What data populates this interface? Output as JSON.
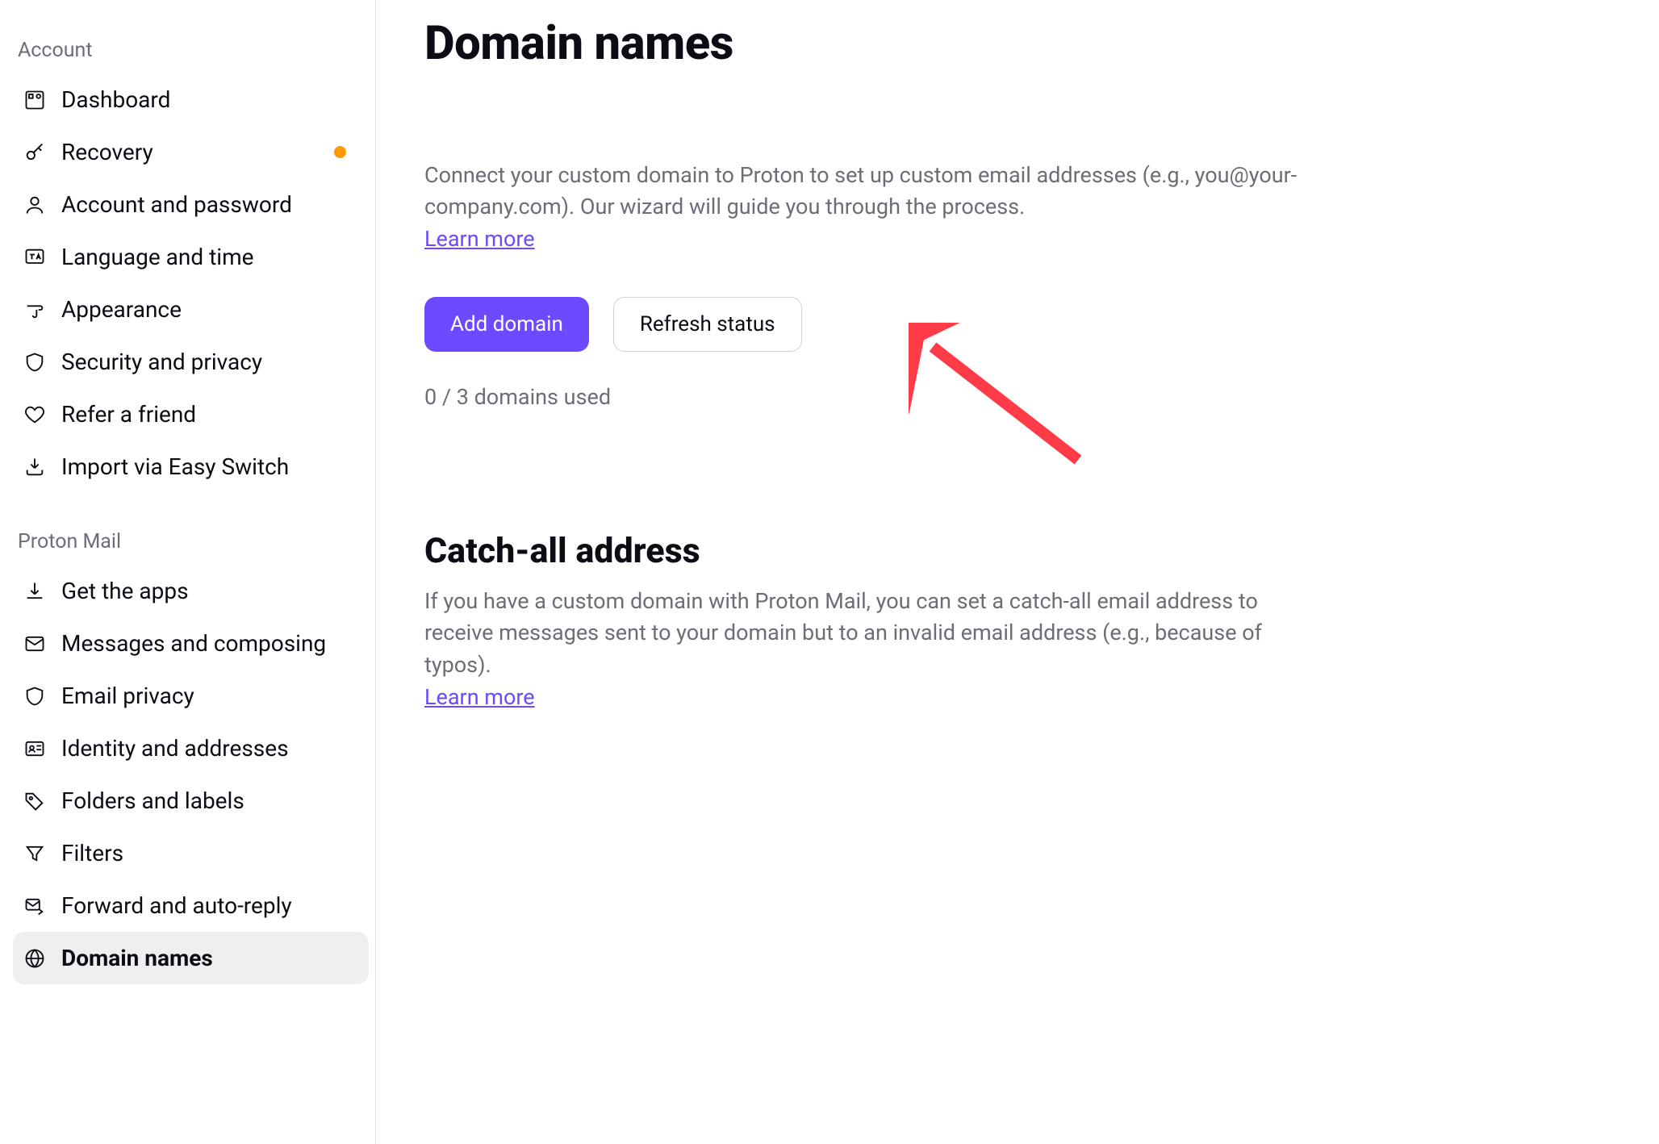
{
  "sidebar": {
    "sections": [
      {
        "header": "Account",
        "items": [
          {
            "label": "Dashboard",
            "icon": "dashboard-icon",
            "hasDot": false,
            "active": false
          },
          {
            "label": "Recovery",
            "icon": "key-icon",
            "hasDot": true,
            "active": false
          },
          {
            "label": "Account and password",
            "icon": "user-icon",
            "hasDot": false,
            "active": false
          },
          {
            "label": "Language and time",
            "icon": "language-icon",
            "hasDot": false,
            "active": false
          },
          {
            "label": "Appearance",
            "icon": "brush-icon",
            "hasDot": false,
            "active": false
          },
          {
            "label": "Security and privacy",
            "icon": "shield-icon",
            "hasDot": false,
            "active": false
          },
          {
            "label": "Refer a friend",
            "icon": "heart-icon",
            "hasDot": false,
            "active": false
          },
          {
            "label": "Import via Easy Switch",
            "icon": "import-icon",
            "hasDot": false,
            "active": false
          }
        ]
      },
      {
        "header": "Proton Mail",
        "items": [
          {
            "label": "Get the apps",
            "icon": "download-icon",
            "hasDot": false,
            "active": false
          },
          {
            "label": "Messages and composing",
            "icon": "envelope-icon",
            "hasDot": false,
            "active": false
          },
          {
            "label": "Email privacy",
            "icon": "shield-icon",
            "hasDot": false,
            "active": false
          },
          {
            "label": "Identity and addresses",
            "icon": "id-icon",
            "hasDot": false,
            "active": false
          },
          {
            "label": "Folders and labels",
            "icon": "tag-icon",
            "hasDot": false,
            "active": false
          },
          {
            "label": "Filters",
            "icon": "filter-icon",
            "hasDot": false,
            "active": false
          },
          {
            "label": "Forward and auto-reply",
            "icon": "forward-icon",
            "hasDot": false,
            "active": false
          },
          {
            "label": "Domain names",
            "icon": "globe-icon",
            "hasDot": false,
            "active": true
          }
        ]
      }
    ]
  },
  "main": {
    "pageTitle": "Domain names",
    "domainSection": {
      "desc": "Connect your custom domain to Proton to set up custom email addresses (e.g., you@your-company.com). Our wizard will guide you through the process.",
      "learnMore": "Learn more",
      "addButton": "Add domain",
      "refreshButton": "Refresh status",
      "usage": "0 / 3 domains used"
    },
    "catchAllSection": {
      "title": "Catch-all address",
      "desc": "If you have a custom domain with Proton Mail, you can set a catch-all email address to receive messages sent to your domain but to an invalid email address (e.g., because of typos).",
      "learnMore": "Learn more"
    }
  },
  "colors": {
    "accent": "#6d4aff",
    "notif": "#ff9900"
  }
}
